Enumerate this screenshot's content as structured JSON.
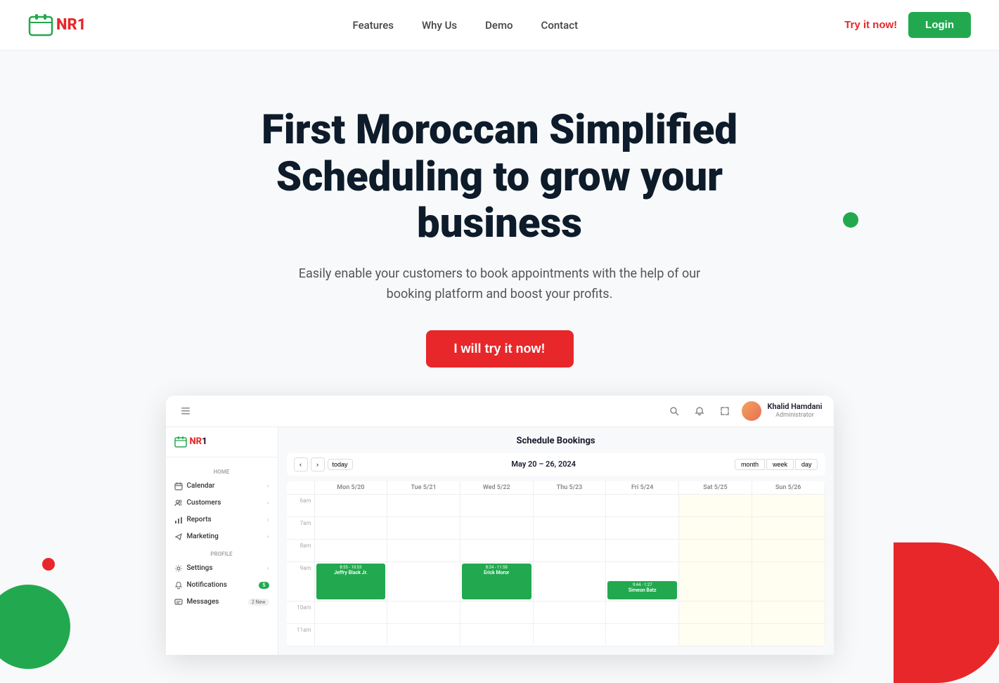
{
  "navbar": {
    "logo_text": "NR1",
    "logo_text_prefix": "",
    "nav_items": [
      {
        "label": "Features",
        "href": "#"
      },
      {
        "label": "Why Us",
        "href": "#"
      },
      {
        "label": "Demo",
        "href": "#"
      },
      {
        "label": "Contact",
        "href": "#"
      }
    ],
    "try_label": "Try it now!",
    "login_label": "Login"
  },
  "hero": {
    "heading": "First Moroccan Simplified Scheduling to grow your business",
    "subtext": "Easily enable your customers to book appointments with the help of our booking platform and boost your profits.",
    "cta_label": "I will try it now!"
  },
  "dashboard": {
    "topbar": {
      "user_name": "Khalid Hamdani",
      "user_role": "Administrator"
    },
    "sidebar": {
      "logo": "NR1",
      "home_section": "HOME",
      "home_items": [
        {
          "label": "Calendar",
          "icon": "calendar"
        },
        {
          "label": "Customers",
          "icon": "users"
        },
        {
          "label": "Reports",
          "icon": "bar-chart"
        },
        {
          "label": "Marketing",
          "icon": "send"
        }
      ],
      "profile_section": "PROFILE",
      "profile_items": [
        {
          "label": "Settings",
          "icon": "settings",
          "badge": ""
        },
        {
          "label": "Notifications",
          "icon": "bell",
          "badge": "5"
        },
        {
          "label": "Messages",
          "icon": "message",
          "badge": "2 New"
        }
      ]
    },
    "main": {
      "title": "Schedule Bookings",
      "calendar": {
        "range": "May 20 – 26, 2024",
        "today_label": "today",
        "view_month": "month",
        "view_week": "week",
        "view_day": "day",
        "days": [
          {
            "label": "Mon 5/20"
          },
          {
            "label": "Tue 5/21"
          },
          {
            "label": "Wed 5/22"
          },
          {
            "label": "Thu 5/23"
          },
          {
            "label": "Fri 5/24"
          },
          {
            "label": "Sat 5/25"
          },
          {
            "label": "Sun 5/26"
          }
        ],
        "time_slots": [
          "6am",
          "7am",
          "8am",
          "9am",
          "10am",
          "11am"
        ],
        "bookings": [
          {
            "day": 0,
            "slot": 3,
            "time": "8:55 – 10:53",
            "name": "Jeffry Black Jr.",
            "color": "green",
            "span": 2
          },
          {
            "day": 2,
            "slot": 3,
            "time": "8:24 – 11:58",
            "name": "Erick Moror",
            "color": "green",
            "span": 2
          },
          {
            "day": 3,
            "slot": 4,
            "time": "9:44 – 1:27",
            "name": "Simeon Batz",
            "color": "green",
            "span": 1
          }
        ]
      }
    }
  }
}
